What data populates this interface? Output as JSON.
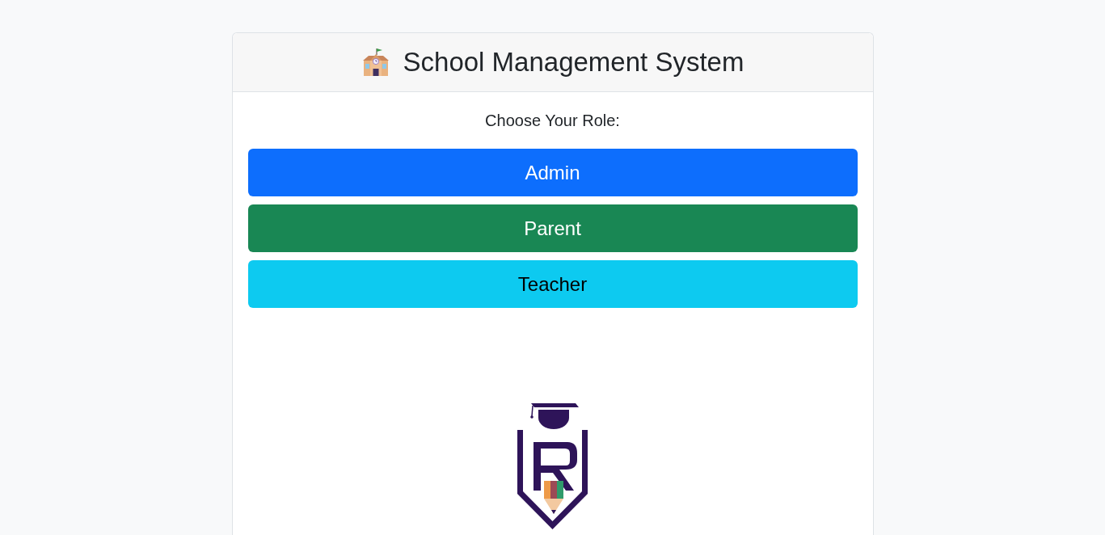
{
  "header": {
    "title": "School Management System"
  },
  "prompt": "Choose Your Role:",
  "roles": [
    {
      "label": "Admin",
      "kind": "primary"
    },
    {
      "label": "Parent",
      "kind": "success"
    },
    {
      "label": "Teacher",
      "kind": "info"
    }
  ]
}
